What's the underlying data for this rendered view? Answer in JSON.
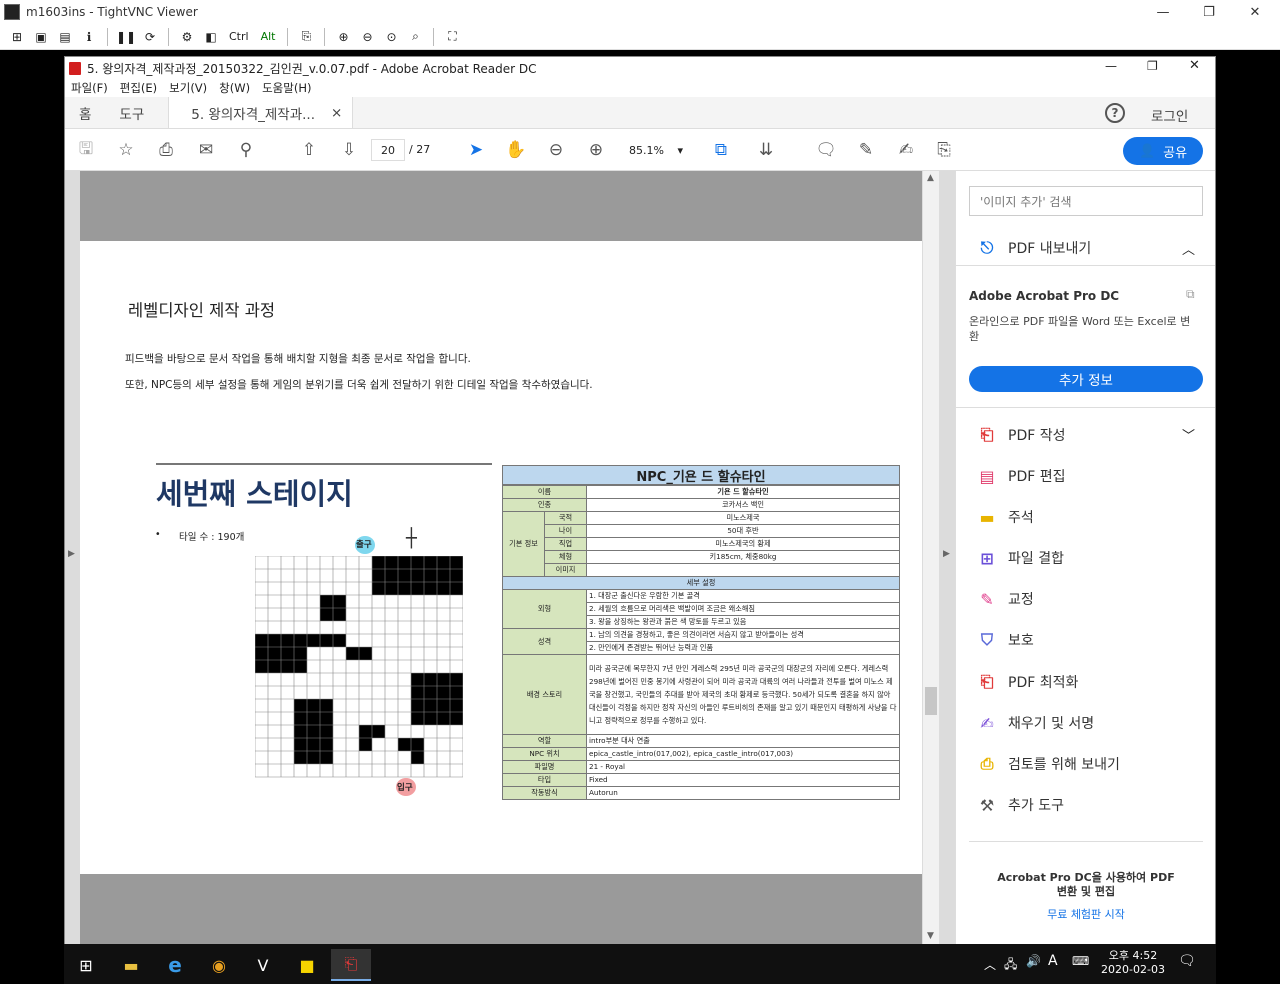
{
  "vnc": {
    "title": "m1603ins - TightVNC Viewer",
    "toolbar": {
      "ctrl": "Ctrl",
      "alt": "Alt"
    }
  },
  "acrobat": {
    "title": "5. 왕의자격_제작과정_20150322_김인권_v.0.07.pdf - Adobe Acrobat Reader DC",
    "menu": [
      "파일(F)",
      "편집(E)",
      "보기(V)",
      "창(W)",
      "도움말(H)"
    ],
    "tabs": {
      "home": "홈",
      "tools": "도구",
      "doc": "5. 왕의자격_제작과...",
      "close": "×"
    },
    "help": "?",
    "login": "로그인",
    "page_current": "20",
    "page_total": "/ 27",
    "zoom": "85.1%",
    "share": "공유"
  },
  "document": {
    "heading": "레벨디자인 제작 과정",
    "para1": "피드백을 바탕으로 문서 작업을 통해 배치할 지형을 최종 문서로 작업을 합니다.",
    "para2": "또한, NPC등의 세부 설정을 통해 게임의 분위기를 더욱 쉽게 전달하기 위한 디테일 작업을 착수하였습니다.",
    "stage_title": "세번째 스테이지",
    "tile_count": "타일 수 : 190개",
    "exit_label": "출구",
    "entry_label": "입구",
    "npc": {
      "title": "NPC_기욘 드 할슈타인",
      "rows": [
        {
          "k": "이름",
          "v": "기욘 드 할슈타인"
        },
        {
          "k": "인종",
          "v": "코카서스 백인"
        }
      ],
      "basic_label": "기본 정보",
      "basic": [
        {
          "k": "국적",
          "v": "미노스제국"
        },
        {
          "k": "나이",
          "v": "50대 후반"
        },
        {
          "k": "직업",
          "v": "미노스제국의 황제"
        },
        {
          "k": "체형",
          "v": "키185cm, 체중80kg"
        },
        {
          "k": "이미지",
          "v": ""
        }
      ],
      "detail_header": "세부 설정",
      "appearance_label": "외형",
      "appearance": [
        "1. 대장군 출신다운 우람한 기본 골격",
        "2. 세월의 흐름으로 머리색은 백발이며 조금은 왜소해짐",
        "3. 왕을 상징하는 왕관과 붉은 색 망토를 두르고 있음"
      ],
      "personality_label": "성격",
      "personality": [
        "1. 남의 의견을 경청하고, 좋은 의견이라면 서슴지 않고 받아들이는 성격",
        "2. 만인에게 존경받는 뛰어난 능력과 인품"
      ],
      "story_label": "배경 스토리",
      "story": "미라 공국군에 복무한지 7년 만인 게레스력 295년 미라 공국군의 대장군의 자리에 오른다. 게레스력 298년에 벌어진 민중 봉기에 사령관이 되어 미라 공국과 대륙의 여러 나라들과 전투를 벌여 미노스 제국을 창건했고, 국민들의 추대를 받아 제국의 초대 황제로 등극했다. 50세가 되도록 결혼을 하지 않아 대신들이 걱정을 하지만 정작 자신의 아들인 루트비히의 존재를 알고 있기 때문인지 태평하게 사냥을 다니고 정략적으로 정무를 수행하고 있다.",
      "extra": [
        {
          "k": "역할",
          "v": "intro부분 대사 연출"
        },
        {
          "k": "NPC 위치",
          "v": "epica_castle_intro(017,002), epica_castle_intro(017,003)"
        },
        {
          "k": "파일명",
          "v": "21 - Royal"
        },
        {
          "k": "타입",
          "v": "Fixed"
        },
        {
          "k": "작동방식",
          "v": "Autorun"
        }
      ]
    }
  },
  "right_panel": {
    "search_placeholder": "'이미지 추가' 검색",
    "export_pdf": "PDF 내보내기",
    "pro_title": "Adobe Acrobat Pro DC",
    "pro_desc": "온라인으로 PDF 파일을 Word 또는 Excel로 변환",
    "more_info": "추가 정보",
    "tools": [
      "PDF 작성",
      "PDF 편집",
      "주석",
      "파일 결합",
      "교정",
      "보호",
      "PDF 최적화",
      "채우기 및 서명",
      "검토를 위해 보내기",
      "추가 도구"
    ],
    "promo_title": "Acrobat Pro DC을 사용하여 PDF 변환 및 편집",
    "trial": "무료 체험판 시작"
  },
  "taskbar": {
    "time": "오후 4:52",
    "date": "2020-02-03",
    "ime": "A"
  },
  "colors": {
    "accent": "#1473e6",
    "table_header": "#bdd7ee",
    "table_label": "#d6e5bd"
  }
}
